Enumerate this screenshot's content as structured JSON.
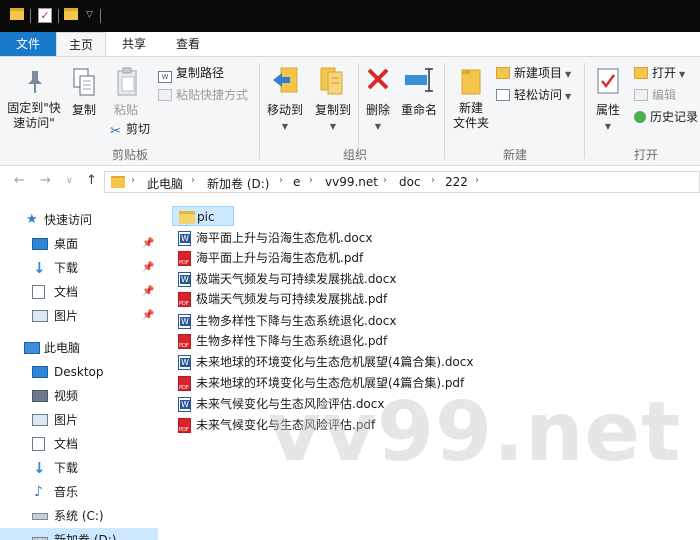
{
  "ribbon_tabs": [
    {
      "label": "文件"
    },
    {
      "label": "主页"
    },
    {
      "label": "共享"
    },
    {
      "label": "查看"
    }
  ],
  "ribbon": {
    "pin_quick_access": "固定到\"快\n速访问\"",
    "copy": "复制",
    "paste": "粘贴",
    "copy_path": "复制路径",
    "paste_shortcut": "粘贴快捷方式",
    "cut": "剪切",
    "group_clipboard": "剪贴板",
    "move_to": "移动到",
    "copy_to": "复制到",
    "delete": "删除",
    "rename": "重命名",
    "group_organize": "组织",
    "new_folder": "新建\n文件夹",
    "new_item": "新建项目",
    "easy_access": "轻松访问",
    "group_new": "新建",
    "properties": "属性",
    "open": "打开",
    "edit": "编辑",
    "history": "历史记录",
    "group_open": "打开"
  },
  "address": {
    "crumbs": [
      "此电脑",
      "新加卷 (D:)",
      "e",
      "vv99.net",
      "doc",
      "222"
    ]
  },
  "nav_pane": {
    "quick_access": "快速访问",
    "quick_items": [
      {
        "label": "桌面",
        "icon": "desktop-icon"
      },
      {
        "label": "下载",
        "icon": "download-icon"
      },
      {
        "label": "文档",
        "icon": "document-icon"
      },
      {
        "label": "图片",
        "icon": "picture-icon"
      }
    ],
    "this_pc": "此电脑",
    "pc_items": [
      {
        "label": "Desktop",
        "icon": "desktop-icon"
      },
      {
        "label": "视频",
        "icon": "video-icon"
      },
      {
        "label": "图片",
        "icon": "picture-icon"
      },
      {
        "label": "文档",
        "icon": "document-icon"
      },
      {
        "label": "下载",
        "icon": "download-icon"
      },
      {
        "label": "音乐",
        "icon": "music-icon"
      },
      {
        "label": "系统 (C:)",
        "icon": "drive-icon"
      },
      {
        "label": "新加卷 (D:)",
        "icon": "drive-icon"
      }
    ]
  },
  "files": [
    {
      "name": "pic",
      "type": "folder"
    },
    {
      "name": "海平面上升与沿海生态危机.docx",
      "type": "docx"
    },
    {
      "name": "海平面上升与沿海生态危机.pdf",
      "type": "pdf"
    },
    {
      "name": "极端天气频发与可持续发展挑战.docx",
      "type": "docx"
    },
    {
      "name": "极端天气频发与可持续发展挑战.pdf",
      "type": "pdf"
    },
    {
      "name": "生物多样性下降与生态系统退化.docx",
      "type": "docx"
    },
    {
      "name": "生物多样性下降与生态系统退化.pdf",
      "type": "pdf"
    },
    {
      "name": "未来地球的环境变化与生态危机展望(4篇合集).docx",
      "type": "docx"
    },
    {
      "name": "未来地球的环境变化与生态危机展望(4篇合集).pdf",
      "type": "pdf"
    },
    {
      "name": "未来气候变化与生态风险评估.docx",
      "type": "docx"
    },
    {
      "name": "未来气候变化与生态风险评估.pdf",
      "type": "pdf"
    }
  ],
  "watermark": "vv99.net",
  "colors": {
    "accent": "#1979ca",
    "selection": "#cce8ff",
    "folder": "#f5d36b",
    "pdf": "#d8232a",
    "word": "#2b579a"
  }
}
